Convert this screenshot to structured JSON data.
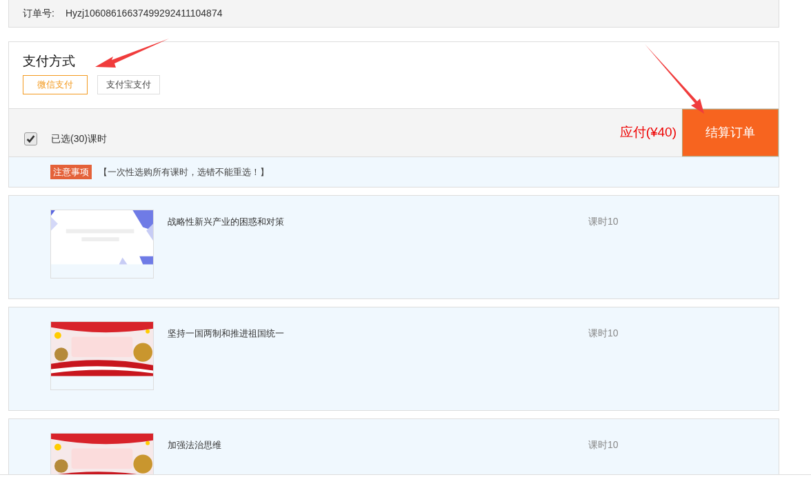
{
  "order": {
    "label": "订单号:",
    "number": "Hyzj10608616637499292411104874"
  },
  "payment": {
    "title": "支付方式",
    "options": [
      {
        "label": "微信支付",
        "selected": true
      },
      {
        "label": "支付宝支付",
        "selected": false
      }
    ]
  },
  "checkout": {
    "checked": true,
    "selected_text": "已选(30)课时",
    "amount": "应付(¥40)",
    "button": "结算订单"
  },
  "notice": {
    "tag": "注意事项",
    "text": "【一次性选购所有课时，选错不能重选！】"
  },
  "courses": [
    {
      "title": "战略性新兴产业的困惑和对策",
      "hours": "课时10",
      "kind": "slide"
    },
    {
      "title": "坚持一国两制和推进祖国统一",
      "hours": "课时10",
      "kind": "festive"
    },
    {
      "title": "加强法治思维",
      "hours": "课时10",
      "kind": "festive"
    }
  ]
}
